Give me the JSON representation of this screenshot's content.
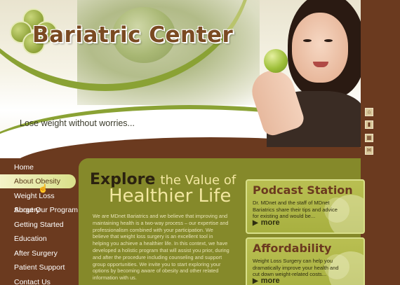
{
  "brand": {
    "name": "Bariatric Center",
    "tagline": "Lose weight without worries..."
  },
  "side_icons": [
    "home-icon",
    "bookmark-icon",
    "sitemap-icon",
    "mail-icon"
  ],
  "nav": {
    "items": [
      {
        "label": "Home"
      },
      {
        "label": "About Obesity"
      },
      {
        "label": "Weight Loss Surgery"
      },
      {
        "label": "About Our Program"
      },
      {
        "label": "Getting Started"
      },
      {
        "label": "Education"
      },
      {
        "label": "After Surgery"
      },
      {
        "label": "Patient Support"
      },
      {
        "label": "Contact Us"
      }
    ],
    "active_index": 1
  },
  "hero": {
    "explore_word": "Explore",
    "explore_rest": "the Value of",
    "healthier": "Healthier Life",
    "body": "We are MDnet Bariatrics and we believe that improving and maintaining health is a two-way process – our expertise and professionalism combined with your participation. We believe that weight loss surgery is an excellent tool in helping you achieve a healthier life. In this context, we have developed a holistic program that will assist you prior, during and after the procedure including counseling and support group opportunities. We invite you to start exploring your options by becoming aware of obesity and other related information with us."
  },
  "cards": [
    {
      "title": "Podcast Station",
      "text": "Dr. MDnet and the staff of MDnet Bariatrics share their tips and advice for existing and would be...",
      "more": "more"
    },
    {
      "title": "Affordability",
      "text": "Weight Loss Surgery can help you dramatically improve your health and cut down weight-related costs...",
      "more": "more"
    }
  ],
  "colors": {
    "brown": "#6b3a1f",
    "olive": "#85892a",
    "card": "#b9bf52",
    "accent_text": "#f2e7a0"
  }
}
